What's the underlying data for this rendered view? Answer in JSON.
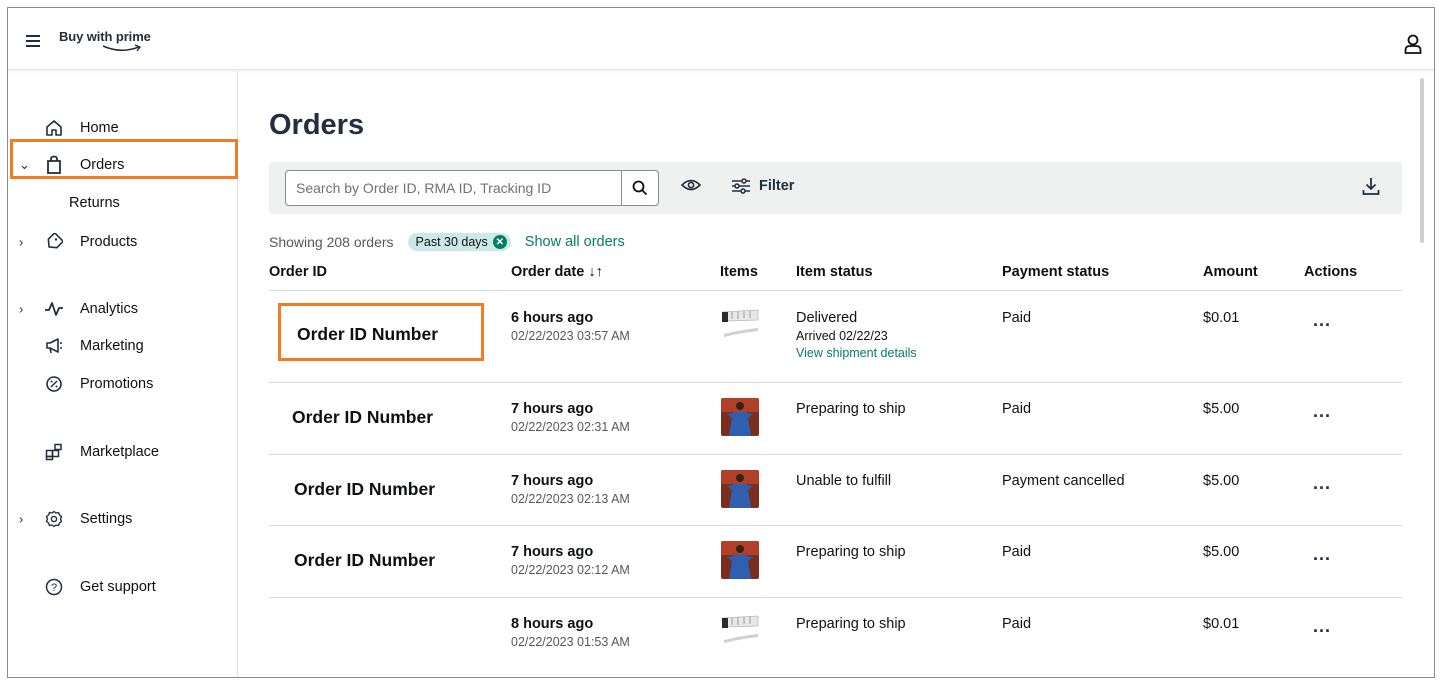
{
  "header": {
    "logo_text": "Buy with prime",
    "menu_icon": "hamburger-icon",
    "user_icon": "user-icon"
  },
  "sidebar": {
    "items": [
      {
        "label": "Home",
        "icon": "home-icon"
      },
      {
        "label": "Orders",
        "icon": "shopping-bag-icon"
      },
      {
        "label": "Returns"
      },
      {
        "label": "Products",
        "icon": "tag-icon"
      },
      {
        "label": "Analytics",
        "icon": "pulse-icon"
      },
      {
        "label": "Marketing",
        "icon": "megaphone-icon"
      },
      {
        "label": "Promotions",
        "icon": "promotion-icon"
      },
      {
        "label": "Marketplace",
        "icon": "marketplace-icon"
      },
      {
        "label": "Settings",
        "icon": "gear-icon"
      },
      {
        "label": "Get support",
        "icon": "help-icon"
      }
    ]
  },
  "main": {
    "title": "Orders",
    "search_placeholder": "Search by Order ID, RMA ID, Tracking ID",
    "filter_label": "Filter",
    "showing_text": "Showing 208 orders",
    "date_badge": "Past 30 days",
    "show_all_label": "Show all orders"
  },
  "table": {
    "columns": [
      "Order ID",
      "Order date ↓↑",
      "Items",
      "Item status",
      "Payment status",
      "Amount",
      "Actions"
    ],
    "rows": [
      {
        "order_id": "Order ID Number",
        "date_rel": "6 hours ago",
        "date_abs": "02/22/2023 03:57 AM",
        "item": "band",
        "status": "Delivered",
        "status_sub": "Arrived 02/22/23",
        "status_link": "View shipment details",
        "payment": "Paid",
        "amount": "$0.01",
        "actions": "..."
      },
      {
        "order_id": "Order ID Number",
        "date_rel": "7 hours ago",
        "date_abs": "02/22/2023 02:31 AM",
        "item": "doll",
        "status": "Preparing to ship",
        "payment": "Paid",
        "amount": "$5.00",
        "actions": "..."
      },
      {
        "order_id": "Order ID Number",
        "date_rel": "7 hours ago",
        "date_abs": "02/22/2023 02:13 AM",
        "item": "doll",
        "status": "Unable to fulfill",
        "payment": "Payment cancelled",
        "amount": "$5.00",
        "actions": "..."
      },
      {
        "order_id": "Order ID Number",
        "date_rel": "7 hours ago",
        "date_abs": "02/22/2023 02:12 AM",
        "item": "doll",
        "status": "Preparing to ship",
        "payment": "Paid",
        "amount": "$5.00",
        "actions": "..."
      },
      {
        "order_id": "",
        "date_rel": "8 hours ago",
        "date_abs": "02/22/2023 01:53 AM",
        "item": "band",
        "status": "Preparing to ship",
        "payment": "Paid",
        "amount": "$0.01",
        "actions": "..."
      }
    ]
  },
  "colors": {
    "highlight": "#f47c20",
    "link": "#067d62",
    "badge_bg": "#cbeae7",
    "toolbar_bg": "#eff1f1"
  }
}
